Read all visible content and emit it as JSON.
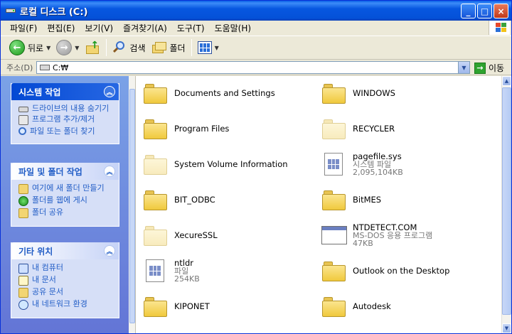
{
  "window": {
    "title": "로컬 디스크 (C:)"
  },
  "title_buttons": {
    "minimize": "_",
    "maximize": "□",
    "close": "×"
  },
  "menu": [
    "파일(F)",
    "편집(E)",
    "보기(V)",
    "즐겨찾기(A)",
    "도구(T)",
    "도움말(H)"
  ],
  "toolbar": {
    "back": "뒤로",
    "search": "검색",
    "folders": "폴더"
  },
  "address": {
    "label": "주소(D)",
    "value": "C:₩",
    "go": "이동"
  },
  "taskpane": {
    "system": {
      "title": "시스템 작업",
      "items": [
        "드라이브의 내용 숨기기",
        "프로그램 추가/제거",
        "파일 또는 폴더 찾기"
      ]
    },
    "file": {
      "title": "파일 및 폴더 작업",
      "items": [
        "여기에 새 폴더 만들기",
        "폴더를 웹에 게시",
        "폴더 공유"
      ]
    },
    "other": {
      "title": "기타 위치",
      "items": [
        "내 컴퓨터",
        "내 문서",
        "공유 문서",
        "내 네트워크 환경"
      ]
    }
  },
  "files": [
    {
      "name": "Documents and Settings"
    },
    {
      "name": "WINDOWS"
    },
    {
      "name": "Program Files"
    },
    {
      "name": "RECYCLER"
    },
    {
      "name": "System Volume Information"
    },
    {
      "name": "pagefile.sys",
      "type": "시스템 파일",
      "size": "2,095,104KB"
    },
    {
      "name": "BIT_ODBC"
    },
    {
      "name": "BitMES"
    },
    {
      "name": "XecureSSL"
    },
    {
      "name": "NTDETECT.COM",
      "type": "MS-DOS 응용 프로그램",
      "size": "47KB"
    },
    {
      "name": "ntldr",
      "type": "파일",
      "size": "254KB"
    },
    {
      "name": "Outlook on the Desktop"
    },
    {
      "name": "KIPONET"
    },
    {
      "name": "Autodesk"
    }
  ]
}
